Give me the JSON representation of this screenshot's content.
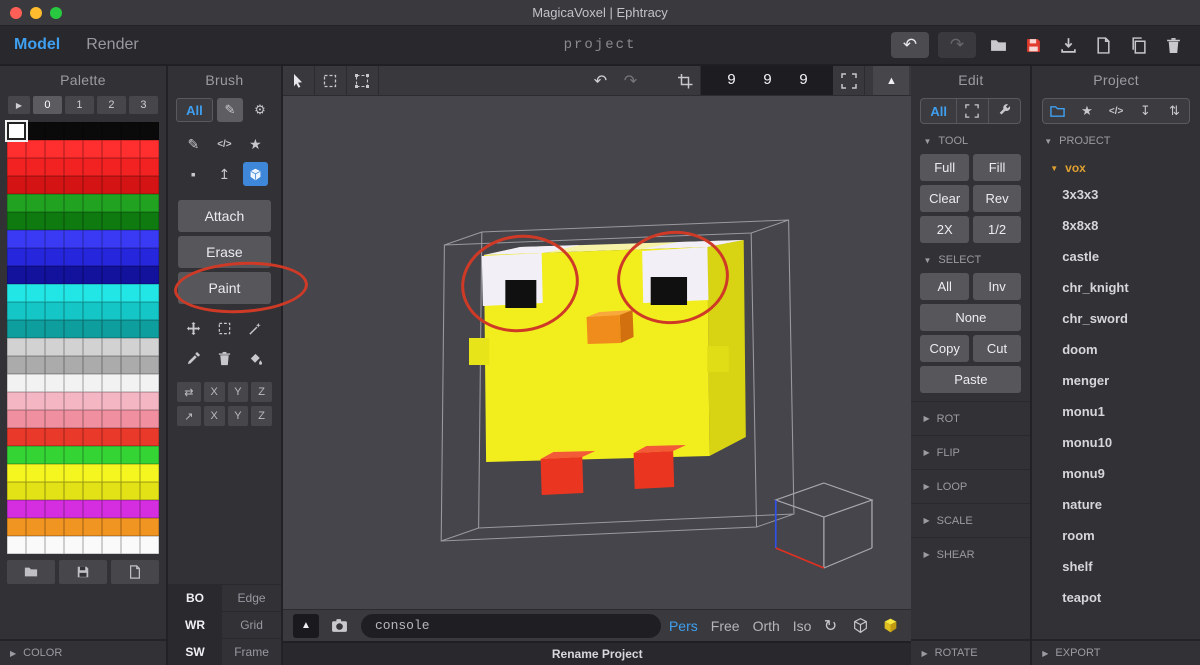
{
  "window": {
    "title": "MagicaVoxel | Ephtracy"
  },
  "menubar": {
    "model_tab": "Model",
    "render_tab": "Render",
    "project_name": "project"
  },
  "palette": {
    "title": "Palette",
    "tabs": [
      "0",
      "1",
      "2",
      "3"
    ],
    "cols": 8,
    "selected_color": "#ffffff",
    "row_colors": [
      "#0a0a0a",
      "#ff2f2f",
      "#f22222",
      "#d41414",
      "#21a321",
      "#0f7a0f",
      "#3a3af5",
      "#2626dd",
      "#12129d",
      "#22e6e6",
      "#14c6c6",
      "#0e9e9e",
      "#d2d2d2",
      "#ababab",
      "#f2f2f2",
      "#f5b6c3",
      "#ef8f9f",
      "#e8392a",
      "#35d435",
      "#f5f520",
      "#e2e216",
      "#d42ee0",
      "#f09422",
      "#fafafa"
    ],
    "color_section_label": "COLOR"
  },
  "brush": {
    "title": "Brush",
    "all_label": "All",
    "modes": [
      "Attach",
      "Erase",
      "Paint"
    ],
    "axes": [
      "X",
      "Y",
      "Z"
    ],
    "display_toggles": [
      [
        "BO",
        "Edge"
      ],
      [
        "WR",
        "Grid"
      ],
      [
        "SW",
        "Frame"
      ]
    ]
  },
  "viewport": {
    "dims": "9 9 9",
    "console_text": "console",
    "views": [
      "Pers",
      "Free",
      "Orth",
      "Iso"
    ],
    "active_view": "Pers",
    "rename_label": "Rename Project"
  },
  "edit": {
    "title": "Edit",
    "all_label": "All",
    "tool_section": "TOOL",
    "tool_buttons": [
      "Full",
      "Fill",
      "Clear",
      "Rev",
      "2X",
      "1/2"
    ],
    "select_section": "SELECT",
    "select_buttons": [
      "All",
      "Inv",
      "None",
      "Copy",
      "Cut",
      "Paste"
    ],
    "collapsed_sections": [
      "ROT",
      "FLIP",
      "LOOP",
      "SCALE",
      "SHEAR"
    ],
    "bottom_section": "ROTATE"
  },
  "project": {
    "title": "Project",
    "section_label": "PROJECT",
    "folder_label": "vox",
    "files": [
      "3x3x3",
      "8x8x8",
      "castle",
      "chr_knight",
      "chr_sword",
      "doom",
      "menger",
      "monu1",
      "monu10",
      "monu9",
      "nature",
      "room",
      "shelf",
      "teapot"
    ],
    "export_label": "EXPORT"
  },
  "model": {
    "body": "#f2ee1e",
    "body_side": "#d8d414",
    "body_top": "#f6f2a8",
    "eye_white": "#f3eff7",
    "pupil": "#101010",
    "beak": "#ef8c1c",
    "feet": "#ea3620"
  },
  "colors": {
    "accent_blue": "#3f9ff0",
    "save_red": "#e23b2e",
    "vox_orange": "#e0a030",
    "annotation_red": "#cf3a27"
  },
  "icons": {
    "undo": "↶",
    "redo": "↷",
    "play": "▶",
    "triangle_up": "▲",
    "star": "★",
    "pencil": "✎",
    "gear": "⚙",
    "code": "</>",
    "square": "▪",
    "extrude": "↥",
    "rotate": "↻",
    "mirror": "⇄",
    "diagonal": "↗",
    "sort_down": "↧",
    "sort_updown": "⇅",
    "collapse_open": "▼",
    "collapse_closed": "▶"
  }
}
